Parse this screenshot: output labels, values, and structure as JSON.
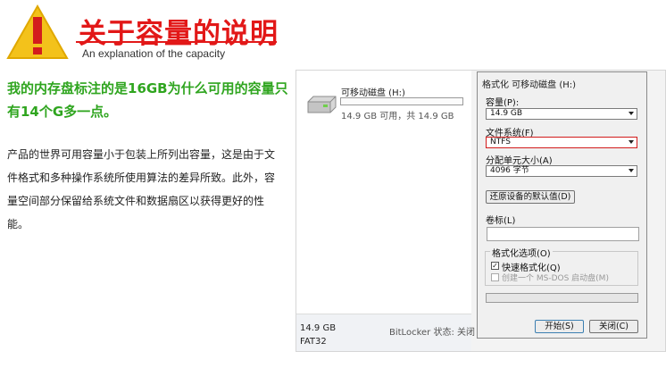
{
  "header": {
    "title": "关于容量的说明",
    "subtitle": "An explanation of the capacity",
    "warning_icon": "warning-triangle-icon",
    "title_color": "#e21818",
    "icon_color": "#f3c21b"
  },
  "question": {
    "text": "我的内存盘标注的是16GB为什么可用的容量只有14个G多一点。",
    "color": "#2fa51f"
  },
  "explanation": {
    "text": "产品的世界可用容量小于包装上所列出容量，这是由于文件格式和多种操作系统所使用算法的差异所致。此外，容量空间部分保留给系统文件和数据扇区以获得更好的性能。"
  },
  "explorer": {
    "drive_icon": "removable-drive-icon",
    "drive_name": "可移动磁盘 (H:)",
    "drive_space": "14.9 GB 可用，共 14.9 GB",
    "details_size": "14.9 GB",
    "details_fs": "FAT32",
    "details_bitlocker": "BitLocker 状态: 关闭"
  },
  "format_dialog": {
    "title": "格式化 可移动磁盘 (H:)",
    "capacity_label": "容量(P):",
    "capacity_value": "14.9 GB",
    "filesystem_label": "文件系统(F)",
    "filesystem_value": "NTFS",
    "allocation_label": "分配单元大小(A)",
    "allocation_value": "4096 字节",
    "restore_button": "还原设备的默认值(D)",
    "volume_label": "卷标(L)",
    "volume_value": "",
    "options_label": "格式化选项(O)",
    "quick_format_label": "快速格式化(Q)",
    "quick_format_checked": true,
    "msdos_label": "创建一个 MS-DOS 启动盘(M)",
    "start_button": "开始(S)",
    "close_button": "关闭(C)",
    "highlight_color": "#d21b1b"
  }
}
